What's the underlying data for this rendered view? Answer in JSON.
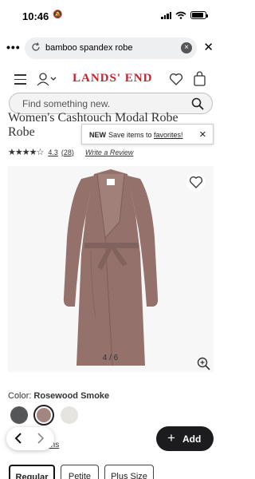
{
  "status_bar": {
    "time": "10:46",
    "battery_level": 0.85
  },
  "browser": {
    "url_text": "bamboo spandex robe",
    "more_label": "•••",
    "clear_label": "×",
    "close_label": "✕"
  },
  "header": {
    "logo": "LANDS' END"
  },
  "site_search": {
    "placeholder": "Find something new."
  },
  "product": {
    "title_line1": "Women's Cashtouch Modal Robe",
    "title_line2": "Robe",
    "rating_stars": "★★★★☆",
    "rating_value": "4.3",
    "review_count": "(28)",
    "write_review": "Write a Review",
    "image_counter": "4 / 6",
    "dress_color": "#94716b"
  },
  "toast": {
    "new_label": "NEW",
    "text": "Save items to",
    "link": "favorites!",
    "close_label": "✕"
  },
  "color": {
    "label": "Color:",
    "name": "Rosewood Smoke",
    "swatches": [
      "#545658",
      "#a38680",
      "#e6e4df"
    ]
  },
  "size_options_label": "options",
  "add_button": {
    "plus": "+",
    "label": "Add"
  },
  "fit_buttons": [
    "Regular",
    "Petite",
    "Plus Size"
  ]
}
